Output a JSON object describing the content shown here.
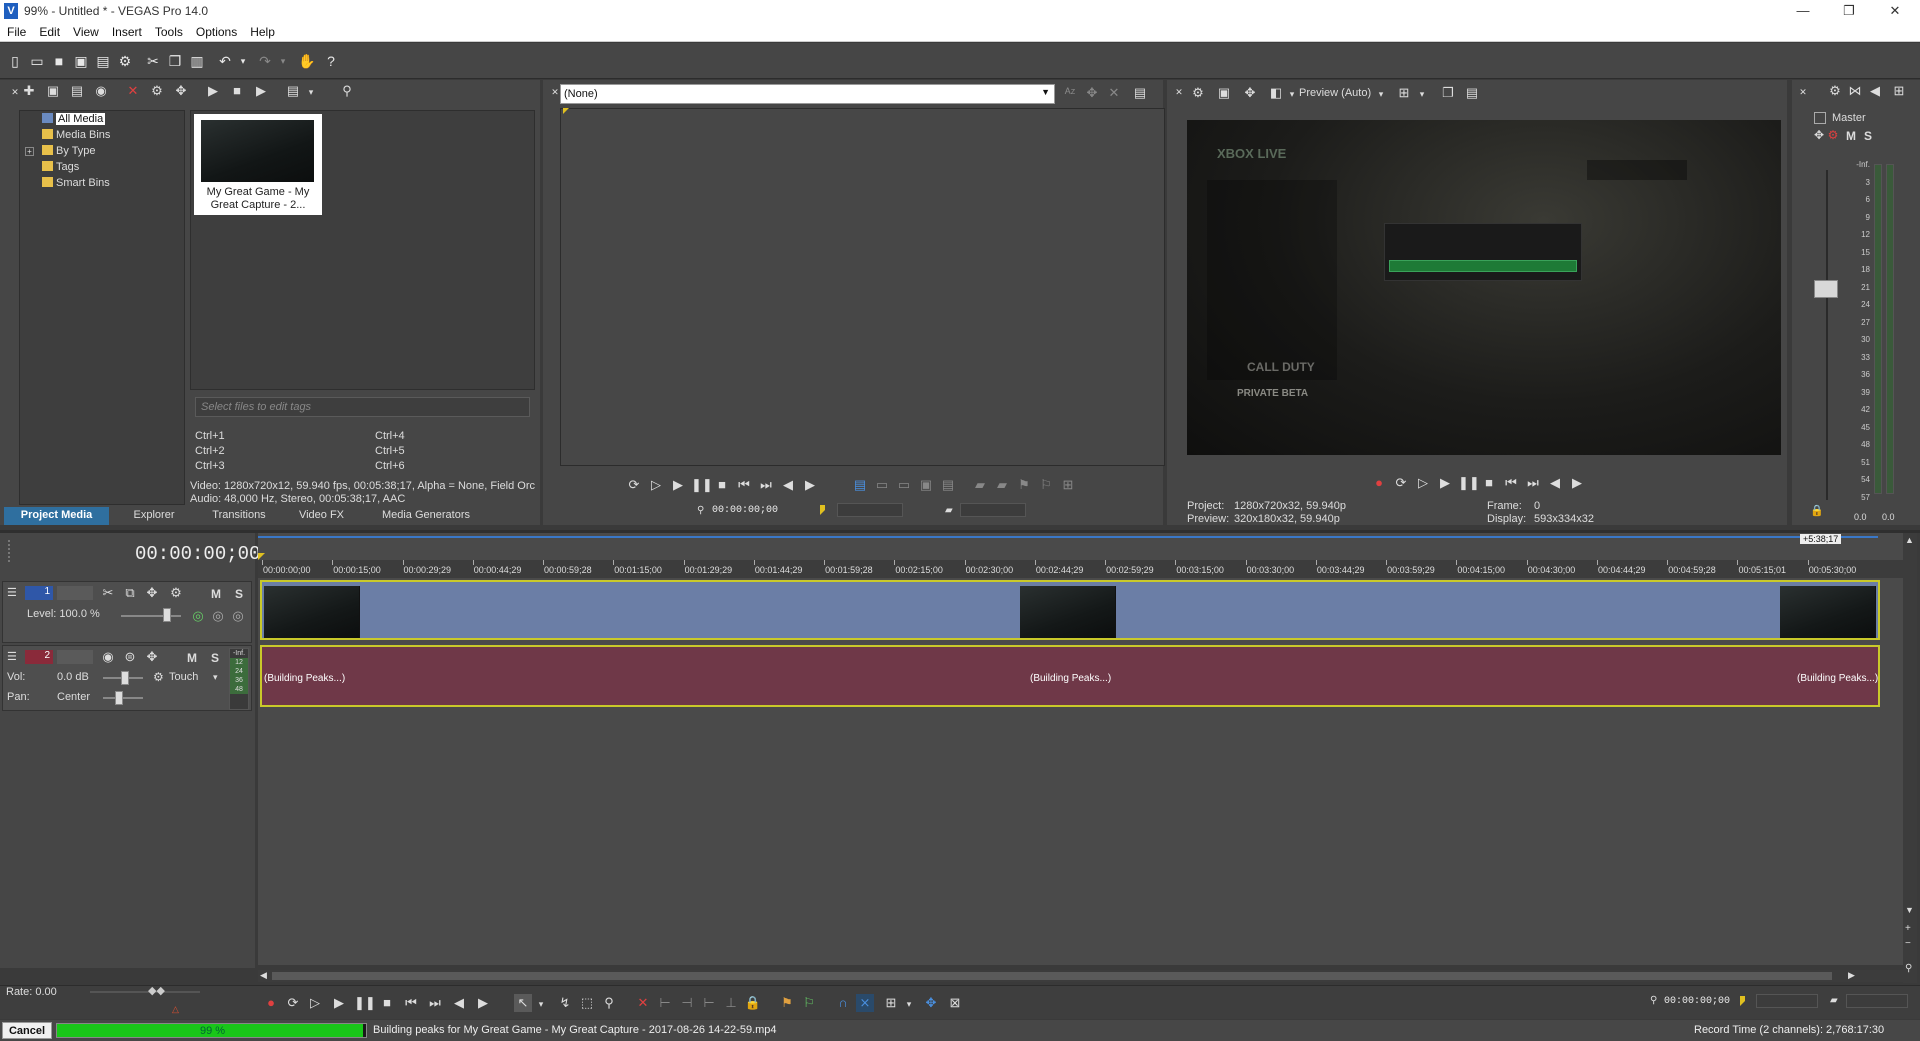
{
  "window": {
    "title": "99% - Untitled * - VEGAS Pro 14.0",
    "logo_text": "V",
    "controls": [
      "—",
      "❐",
      "✕"
    ]
  },
  "menu": [
    "File",
    "Edit",
    "View",
    "Insert",
    "Tools",
    "Options",
    "Help"
  ],
  "project_media": {
    "tree": [
      {
        "label": "All Media",
        "selected": true
      },
      {
        "label": "Media Bins"
      },
      {
        "label": "By Type",
        "expandable": true
      },
      {
        "label": "Tags"
      },
      {
        "label": "Smart Bins"
      }
    ],
    "media_item": {
      "name_line1": "My Great Game - My",
      "name_line2": "Great Capture - 2..."
    },
    "tag_placeholder": "Select files to edit tags",
    "shortcuts": [
      "Ctrl+1",
      "Ctrl+2",
      "Ctrl+3",
      "Ctrl+4",
      "Ctrl+5",
      "Ctrl+6"
    ],
    "info_line1": "Video: 1280x720x12, 59.940 fps, 00:05:38;17, Alpha = None, Field Orc",
    "info_line2": "Audio: 48,000 Hz, Stereo, 00:05:38;17, AAC",
    "tabs": [
      "Project Media",
      "Explorer",
      "Transitions",
      "Video FX",
      "Media Generators"
    ],
    "active_tab": "Project Media"
  },
  "trimmer": {
    "selection": "(None)",
    "timecode": "00:00:00;00"
  },
  "preview": {
    "mode_label": "Preview (Auto)",
    "project_label": "Project:",
    "project_value": "1280x720x32, 59.940p",
    "preview_label": "Preview:",
    "preview_value": "320x180x32, 59.940p",
    "frame_label": "Frame:",
    "frame_value": "0",
    "display_label": "Display:",
    "display_value": "593x334x32",
    "game_text": {
      "xbox": "XBOX LIVE",
      "cod": "CALL DUTY",
      "beta": "PRIVATE BETA"
    }
  },
  "master": {
    "label": "Master",
    "m": "M",
    "s": "S",
    "scale": [
      "-Inf.",
      "3",
      "6",
      "9",
      "12",
      "15",
      "18",
      "21",
      "24",
      "27",
      "30",
      "33",
      "36",
      "39",
      "42",
      "45",
      "48",
      "51",
      "54",
      "57"
    ],
    "bottom_values": [
      "0.0",
      "0.0"
    ]
  },
  "timeline": {
    "timecode": "00:00:00;00",
    "end_marker": "+5:38;17",
    "ruler_ticks": [
      "00:00:00;00",
      "00:00:15;00",
      "00:00:29;29",
      "00:00:44;29",
      "00:00:59;28",
      "00:01:15;00",
      "00:01:29;29",
      "00:01:44;29",
      "00:01:59;28",
      "00:02:15;00",
      "00:02:30;00",
      "00:02:44;29",
      "00:02:59;29",
      "00:03:15;00",
      "00:03:30;00",
      "00:03:44;29",
      "00:03:59;29",
      "00:04:15;00",
      "00:04:30;00",
      "00:04:44;29",
      "00:04:59;28",
      "00:05:15;01",
      "00:05:30;00"
    ],
    "video_track": {
      "number": "1",
      "level_label": "Level: 100.0 %",
      "m": "M",
      "s": "S"
    },
    "audio_track": {
      "number": "2",
      "vol_label": "Vol:",
      "vol_value": "0.0 dB",
      "pan_label": "Pan:",
      "pan_value": "Center",
      "automation": "Touch",
      "m": "M",
      "s": "S",
      "meter_values": [
        "-Inf.",
        "12",
        "24",
        "36",
        "48"
      ]
    },
    "audio_clip_text": "(Building Peaks...)"
  },
  "transport": {
    "rate_label": "Rate: 0.00",
    "timecode": "00:00:00;00"
  },
  "status": {
    "cancel_label": "Cancel",
    "progress_percent": 99,
    "progress_text": "99 %",
    "message": "Building peaks for My Great Game - My Great Capture - 2017-08-26 14-22-59.mp4",
    "record_time": "Record Time (2 channels): 2,768:17:30"
  },
  "colors": {
    "accent_tab": "#2f6f9f",
    "video_track": "#6b7ea6",
    "audio_track": "#6f3848",
    "selection_border": "#c9c92a",
    "progress": "#19c619"
  }
}
